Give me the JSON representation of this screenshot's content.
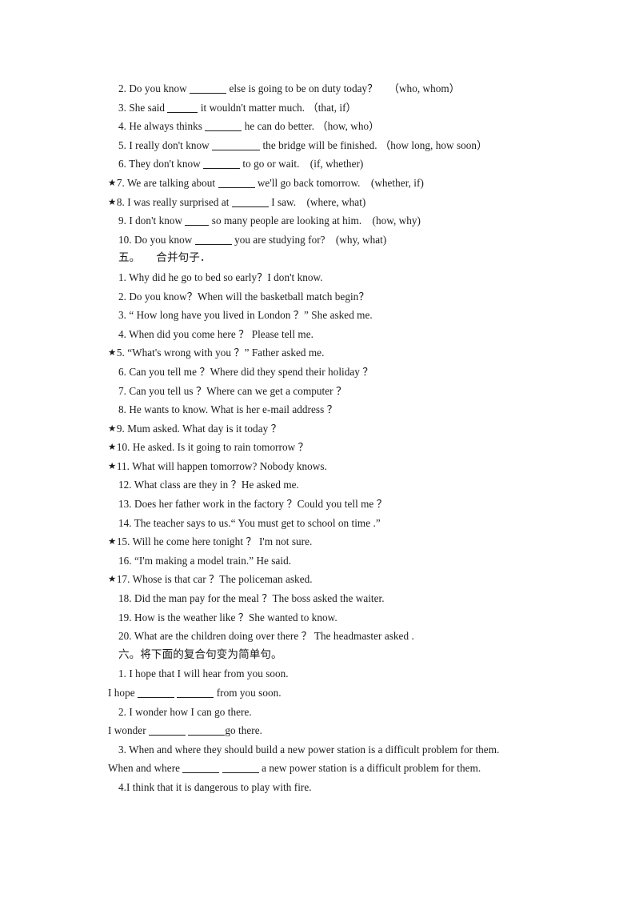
{
  "document": {
    "type": "worksheet",
    "language": "en-zh",
    "background_color": "#ffffff",
    "text_color": "#1b1b1b",
    "star_marker": "★"
  },
  "section_four_continued": {
    "items": [
      {
        "starred": false,
        "number": "2.",
        "pre": "Do you know",
        "blank": "b6",
        "post": "else is going to be on duty today？",
        "options": "（who, whom）"
      },
      {
        "starred": false,
        "number": "3.",
        "pre": "She said",
        "blank": "b5",
        "post": "it wouldn't matter much.",
        "options": "（that, if）"
      },
      {
        "starred": false,
        "number": "4.",
        "pre": "He always thinks",
        "blank": "b6",
        "post": "he can do better.",
        "options": "（how, who）"
      },
      {
        "starred": false,
        "number": "5.",
        "pre": "I really don't know",
        "blank": "b8",
        "post": "the bridge will be finished.",
        "options": "（how long, how soon）"
      },
      {
        "starred": false,
        "number": "6.",
        "pre": "They don't know",
        "blank": "b6",
        "post": "to go or wait.",
        "options": "(if, whether)"
      },
      {
        "starred": true,
        "number": "7.",
        "pre": "We are talking about",
        "blank": "b6",
        "post": "we'll go back tomorrow.",
        "options": "(whether, if)"
      },
      {
        "starred": true,
        "number": "8.",
        "pre": "I was really surprised at",
        "blank": "b6",
        "post": "I saw.",
        "options": "(where, what)"
      },
      {
        "starred": false,
        "number": "9.",
        "pre": "I don't know",
        "blank": "b4",
        "post": "so many people are looking at him.",
        "options": "(how, why)"
      },
      {
        "starred": false,
        "number": "10.",
        "pre": "Do you know",
        "blank": "b6",
        "post": "you are studying for?",
        "options": "(why, what)"
      }
    ]
  },
  "section_five": {
    "heading_number": "五。",
    "heading_gap": "   ",
    "heading_text": "合并句子．",
    "items": [
      {
        "starred": false,
        "number": "1.",
        "text": "Why did he go to bed so early？I don't know."
      },
      {
        "starred": false,
        "number": "2.",
        "text": "Do you know？When will the basketball match begin？"
      },
      {
        "starred": false,
        "number": "3.",
        "text": "“ How long have you lived in London ？” She asked me."
      },
      {
        "starred": false,
        "number": "4.",
        "text": "When did you come here ？    Please tell me."
      },
      {
        "starred": true,
        "number": "5.",
        "text": "“What's wrong with you ？” Father asked me."
      },
      {
        "starred": false,
        "number": "6.",
        "text": "Can you tell me ？Where did they spend their holiday ？"
      },
      {
        "starred": false,
        "number": "7.",
        "text": "Can you tell us ？Where can we get a computer ？"
      },
      {
        "starred": false,
        "number": "8.",
        "text": "He wants to know. What is her e-mail address ？"
      },
      {
        "starred": true,
        "number": "9.",
        "text": "Mum asked. What day is it today ？"
      },
      {
        "starred": true,
        "number": "10.",
        "text": "He asked. Is it going to rain tomorrow ？"
      },
      {
        "starred": true,
        "number": "11.",
        "text": "What will happen tomorrow? Nobody knows."
      },
      {
        "starred": false,
        "number": "12.",
        "text": "What class are they in ？He asked me."
      },
      {
        "starred": false,
        "number": "13.",
        "text": "Does her father work in the factory ？Could you tell me ？"
      },
      {
        "starred": false,
        "number": "14.",
        "text": "The teacher says to us.“ You must get to school on time .”"
      },
      {
        "starred": true,
        "number": "15.",
        "text": "Will he come here tonight ？  I'm not sure."
      },
      {
        "starred": false,
        "number": "16.",
        "text": "“I'm making a model train.”   He said."
      },
      {
        "starred": true,
        "number": "17.",
        "text": "Whose is that car ？The policeman asked."
      },
      {
        "starred": false,
        "number": "18.",
        "text": "Did the man pay for the meal ？The boss asked the waiter."
      },
      {
        "starred": false,
        "number": "19.",
        "text": "How is the weather like ？She wanted to know."
      },
      {
        "starred": false,
        "number": "20.",
        "text": "What are the children doing over there ？  The headmaster asked ."
      }
    ]
  },
  "section_six": {
    "heading": "六。将下面的复合句变为简单句。",
    "items": [
      {
        "number": "1.",
        "prompt": "I hope that I will hear from you soon.",
        "answer_pre": "I hope",
        "answer_blank1": "b6",
        "answer_mid": "",
        "answer_blank2": "b6",
        "answer_post": "from you soon."
      },
      {
        "number": "2.",
        "prompt": "I wonder how I can go there.",
        "answer_pre": "I wonder",
        "answer_blank1": "b6",
        "answer_mid": "",
        "answer_blank2": "b6",
        "answer_post": "go there."
      },
      {
        "number": "3.",
        "prompt": "When and where they should build a new power station is a difficult problem for them.",
        "answer_pre": "When and where",
        "answer_blank1": "b6",
        "answer_mid": "",
        "answer_blank2": "b6",
        "answer_post": "a new power station is a difficult problem for them."
      },
      {
        "number": "4.",
        "prompt": "4.I think   that it is dangerous to play with fire.",
        "answer_pre": "",
        "answer_blank1": "",
        "answer_mid": "",
        "answer_blank2": "",
        "answer_post": ""
      }
    ]
  }
}
